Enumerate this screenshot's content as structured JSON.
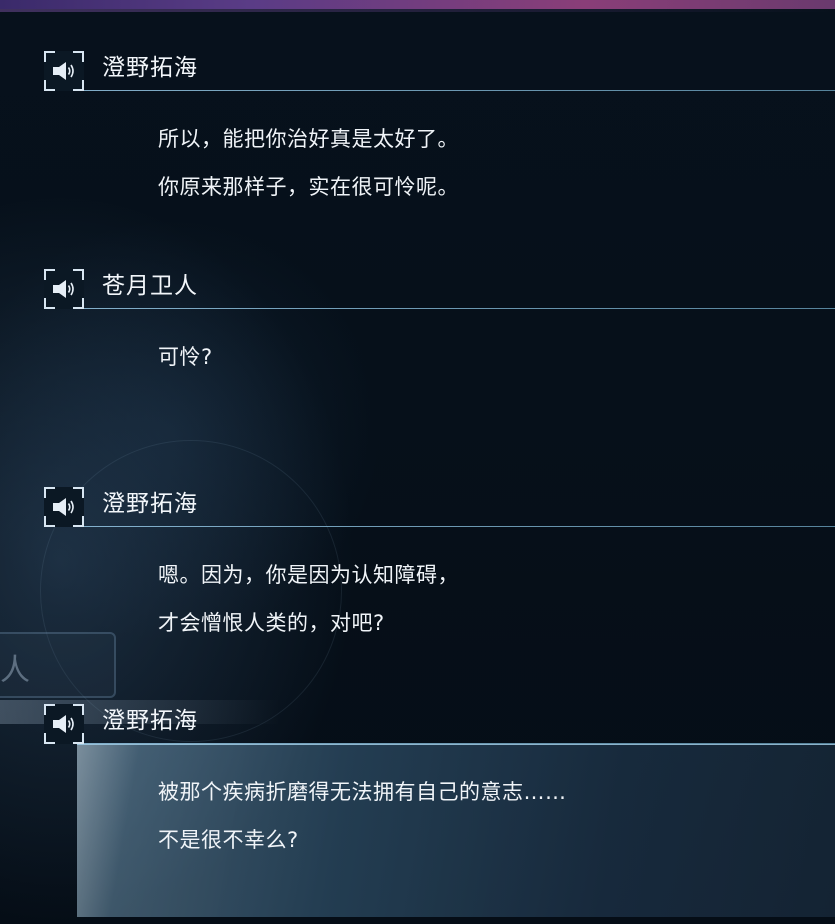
{
  "backlog": {
    "entries": [
      {
        "speaker": "澄野拓海",
        "lines": [
          "所以，能把你治好真是太好了。",
          "你原来那样子，实在很可怜呢。"
        ]
      },
      {
        "speaker": "苍月卫人",
        "lines": [
          "可怜?"
        ]
      },
      {
        "speaker": "澄野拓海",
        "lines": [
          "嗯。因为，你是因为认知障碍，",
          "才会憎恨人类的，对吧?"
        ]
      },
      {
        "speaker": "澄野拓海",
        "lines": [
          "被那个疾病折磨得无法拥有自己的意志……",
          "不是很不幸么?"
        ]
      }
    ],
    "selected_index": 3
  },
  "background": {
    "partial_text": "人"
  },
  "icons": {
    "voice": "speaker-voice-icon"
  },
  "colors": {
    "top_bar": "#5a3c86",
    "rule": "#8fc4e0",
    "text": "#f0f4f8",
    "highlight": "#3c6482"
  }
}
